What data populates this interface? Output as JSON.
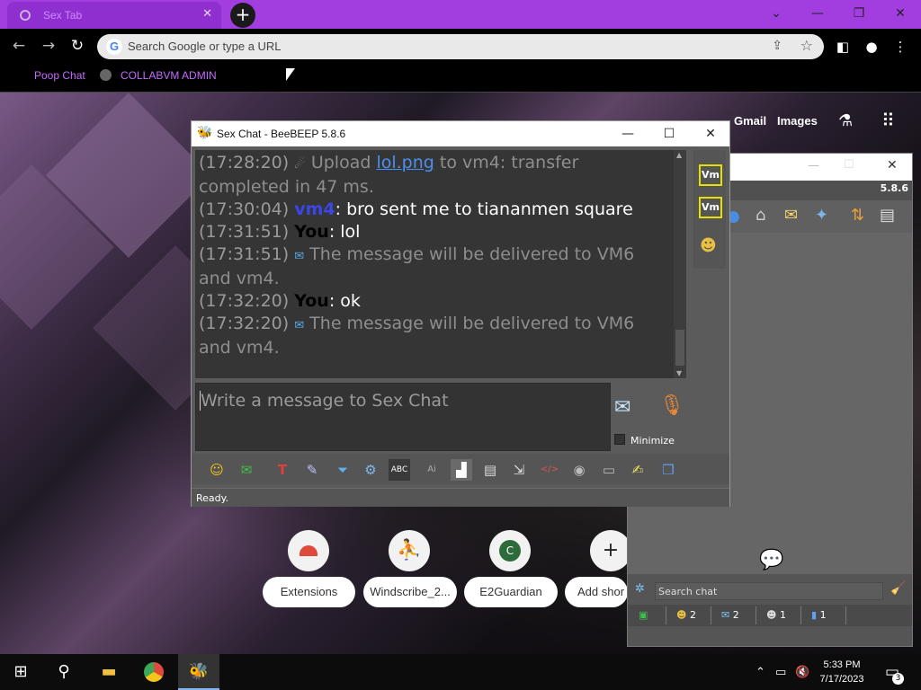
{
  "browser": {
    "tab_title": "Sex Tab",
    "new_tab_symbol": "+",
    "omnibox_placeholder": "Search Google or type a URL",
    "bookmarks": [
      {
        "label": "Poop Chat"
      },
      {
        "label": "COLLABVM ADMIN"
      }
    ],
    "colors": {
      "tabstrip": "#a23ee0",
      "bookmark_text": "#c46bff"
    }
  },
  "newtab_page": {
    "links": [
      "Gmail",
      "Images"
    ],
    "shortcuts": [
      {
        "label": "Extensions",
        "icon": "chrome-web-store-icon"
      },
      {
        "label": "Windscribe_2...",
        "icon": "windscribe-icon"
      },
      {
        "label": "E2Guardian",
        "icon": "c-letter-icon",
        "letter": "C"
      },
      {
        "label": "Add shor",
        "icon": "plus-icon",
        "symbol": "+"
      }
    ]
  },
  "bg_window": {
    "version": "5.8.6",
    "search_placeholder": "Search chat",
    "tabs": [
      {
        "count": ""
      },
      {
        "count": "2"
      },
      {
        "count": "2"
      },
      {
        "count": "1"
      },
      {
        "count": "1"
      }
    ]
  },
  "chat_window": {
    "title": "Sex Chat - BeeBEEP 5.8.6",
    "messages": [
      {
        "time": "(17:28:20)",
        "kind": "upload",
        "pre": " Upload ",
        "link": "lol.png",
        "post": " to vm4: transfer completed in 47 ms."
      },
      {
        "time": "(17:30:04)",
        "kind": "user",
        "sender": "vm4",
        "text": ": bro sent me to tiananmen square"
      },
      {
        "time": "(17:31:51)",
        "kind": "you",
        "sender": "You",
        "text": ": lol"
      },
      {
        "time": "(17:31:51)",
        "kind": "system",
        "text": " The message will be delivered to VM6 and vm4."
      },
      {
        "time": "(17:32:20)",
        "kind": "you",
        "sender": "You",
        "text": ": ok"
      },
      {
        "time": "(17:32:20)",
        "kind": "system",
        "text": " The message will be delivered to VM6 and vm4."
      }
    ],
    "sidebar_buttons": [
      "Vm",
      "Vm"
    ],
    "compose_placeholder": "Write a message to Sex Chat",
    "minimize_label": "Minimize",
    "status": "Ready."
  },
  "taskbar": {
    "time": "5:33 PM",
    "date": "7/17/2023",
    "notifications": "3"
  }
}
